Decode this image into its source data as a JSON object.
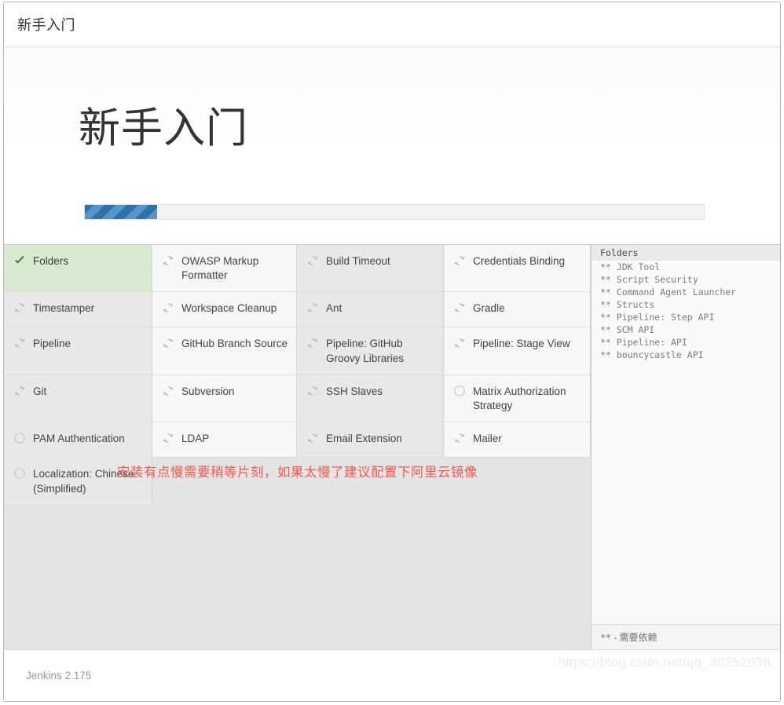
{
  "window": {
    "titlebar_text": "新手入门"
  },
  "hero": {
    "title": "新手入门",
    "progress_percent": 11.7,
    "progress_fill_color": "#2c72b0",
    "progress_stripe_color": "#5b93c4",
    "progress_track_color": "#f3f3f3"
  },
  "legend": {
    "done_color": "#d9ead3",
    "note_color": "#f4574b"
  },
  "plugins": [
    {
      "label": "Folders",
      "status": "done",
      "icon": "check-icon"
    },
    {
      "label": "OWASP Markup Formatter",
      "status": "installing",
      "icon": "sync-icon"
    },
    {
      "label": "Build Timeout",
      "status": "installing",
      "icon": "sync-icon"
    },
    {
      "label": "Credentials Binding",
      "status": "installing",
      "icon": "sync-icon"
    },
    {
      "label": "Timestamper",
      "status": "installing",
      "icon": "sync-icon"
    },
    {
      "label": "Workspace Cleanup",
      "status": "installing",
      "icon": "sync-icon"
    },
    {
      "label": "Ant",
      "status": "installing",
      "icon": "sync-icon"
    },
    {
      "label": "Gradle",
      "status": "installing",
      "icon": "sync-icon"
    },
    {
      "label": "Pipeline",
      "status": "installing",
      "icon": "sync-icon"
    },
    {
      "label": "GitHub Branch Source",
      "status": "installing",
      "icon": "sync-icon"
    },
    {
      "label": "Pipeline: GitHub Groovy Libraries",
      "status": "installing",
      "icon": "sync-icon"
    },
    {
      "label": "Pipeline: Stage View",
      "status": "installing",
      "icon": "sync-icon"
    },
    {
      "label": "Git",
      "status": "installing",
      "icon": "sync-icon"
    },
    {
      "label": "Subversion",
      "status": "installing",
      "icon": "sync-icon"
    },
    {
      "label": "SSH Slaves",
      "status": "installing",
      "icon": "sync-icon"
    },
    {
      "label": "Matrix Authorization Strategy",
      "status": "pending",
      "icon": "circle-icon"
    },
    {
      "label": "PAM Authentication",
      "status": "pending",
      "icon": "circle-icon"
    },
    {
      "label": "LDAP",
      "status": "installing",
      "icon": "sync-icon"
    },
    {
      "label": "Email Extension",
      "status": "installing",
      "icon": "sync-icon"
    },
    {
      "label": "Mailer",
      "status": "installing",
      "icon": "sync-icon"
    },
    {
      "label": "Localization: Chinese (Simplified)",
      "status": "pending",
      "icon": "circle-icon"
    }
  ],
  "log": {
    "header": "Folders",
    "lines": [
      "** JDK Tool",
      "** Script Security",
      "** Command Agent Launcher",
      "** Structs",
      "** Pipeline: Step API",
      "** SCM API",
      "** Pipeline: API",
      "** bouncycastle API"
    ],
    "footer_marker": "**",
    "footer_text": "- 需要依赖"
  },
  "note": {
    "text": "安装有点慢需要稍等片刻，如果太慢了建议配置下阿里云镜像"
  },
  "footer": {
    "version": "Jenkins 2.175",
    "watermark": "https://blog.csdn.net/qq_38252039"
  }
}
